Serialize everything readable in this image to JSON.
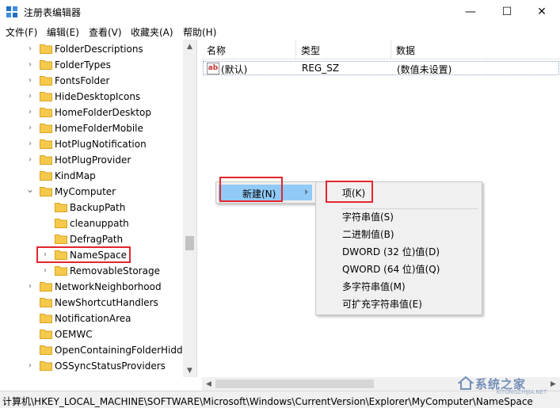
{
  "window": {
    "title": "注册表编辑器",
    "controls": {
      "minimize": "—",
      "maximize": "☐",
      "close": "✕"
    }
  },
  "menu": [
    {
      "label": "文件(F)"
    },
    {
      "label": "编辑(E)"
    },
    {
      "label": "查看(V)"
    },
    {
      "label": "收藏夹(A)"
    },
    {
      "label": "帮助(H)"
    }
  ],
  "tree": [
    {
      "label": "FolderDescriptions",
      "level": 0,
      "expander": "collapsed"
    },
    {
      "label": "FolderTypes",
      "level": 0,
      "expander": "collapsed"
    },
    {
      "label": "FontsFolder",
      "level": 0,
      "expander": "collapsed"
    },
    {
      "label": "HideDesktopIcons",
      "level": 0,
      "expander": "collapsed"
    },
    {
      "label": "HomeFolderDesktop",
      "level": 0,
      "expander": "collapsed"
    },
    {
      "label": "HomeFolderMobile",
      "level": 0,
      "expander": "collapsed"
    },
    {
      "label": "HotPlugNotification",
      "level": 0,
      "expander": "collapsed"
    },
    {
      "label": "HotPlugProvider",
      "level": 0,
      "expander": "collapsed"
    },
    {
      "label": "KindMap",
      "level": 0,
      "expander": "none"
    },
    {
      "label": "MyComputer",
      "level": 0,
      "expander": "expanded"
    },
    {
      "label": "BackupPath",
      "level": 1,
      "expander": "none"
    },
    {
      "label": "cleanuppath",
      "level": 1,
      "expander": "none"
    },
    {
      "label": "DefragPath",
      "level": 1,
      "expander": "none"
    },
    {
      "label": "NameSpace",
      "level": 1,
      "expander": "collapsed",
      "selected": true
    },
    {
      "label": "RemovableStorage",
      "level": 1,
      "expander": "collapsed"
    },
    {
      "label": "NetworkNeighborhood",
      "level": 0,
      "expander": "collapsed"
    },
    {
      "label": "NewShortcutHandlers",
      "level": 0,
      "expander": "none"
    },
    {
      "label": "NotificationArea",
      "level": 0,
      "expander": "none"
    },
    {
      "label": "OEMWC",
      "level": 0,
      "expander": "none"
    },
    {
      "label": "OpenContainingFolderHidde",
      "level": 0,
      "expander": "none"
    },
    {
      "label": "OSSyncStatusProviders",
      "level": 0,
      "expander": "collapsed"
    }
  ],
  "list": {
    "columns": {
      "name": "名称",
      "type": "类型",
      "data": "数据"
    },
    "rows": [
      {
        "icon": "ab",
        "name": "(默认)",
        "type": "REG_SZ",
        "data": "(数值未设置)"
      }
    ]
  },
  "context_menu": {
    "item": "新建(N)",
    "arrow": "›",
    "submenu": [
      {
        "label": "项(K)"
      },
      {
        "label": "字符串值(S)"
      },
      {
        "label": "二进制值(B)"
      },
      {
        "label": "DWORD (32 位)值(D)"
      },
      {
        "label": "QWORD (64 位)值(Q)"
      },
      {
        "label": "多字符串值(M)"
      },
      {
        "label": "可扩充字符串值(E)"
      }
    ]
  },
  "status": {
    "path": "计算机\\HKEY_LOCAL_MACHINE\\SOFTWARE\\Microsoft\\Windows\\CurrentVersion\\Explorer\\MyComputer\\NameSpace"
  },
  "watermark": {
    "text": "系统之家",
    "sub": "XITONGZHIJIA.NET"
  },
  "colors": {
    "highlight": "#e3262b",
    "menu_hover": "#91c9f7",
    "folder": "#f5c94c"
  }
}
